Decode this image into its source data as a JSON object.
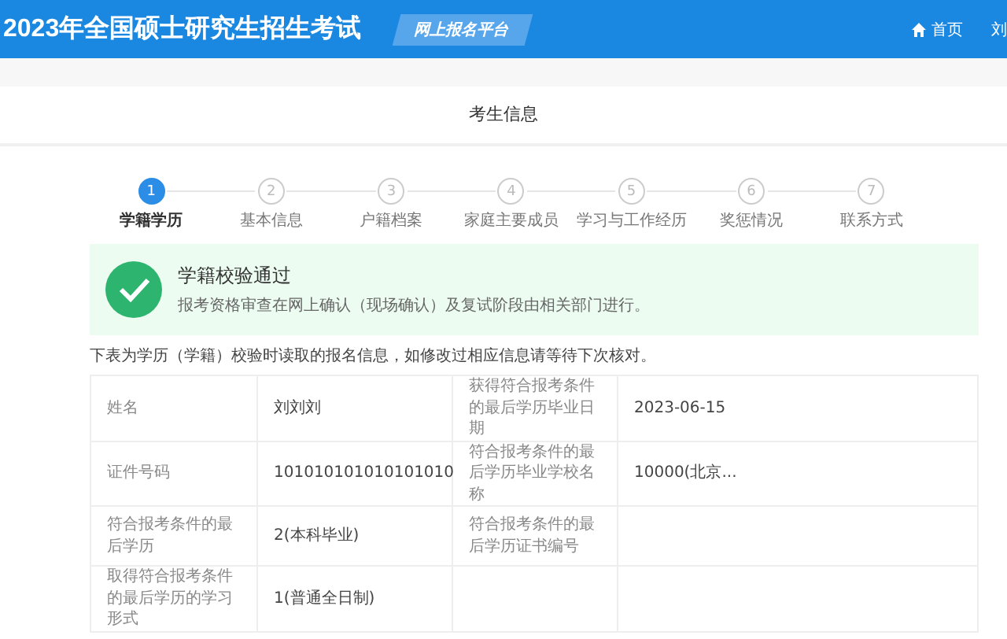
{
  "header": {
    "title": "2023年全国硕士研究生招生考试",
    "platform_badge": "网上报名平台",
    "home_link": "首页",
    "user_name": "刘"
  },
  "page_title": "考生信息",
  "steps": [
    {
      "number": "1",
      "label": "学籍学历",
      "selected": true
    },
    {
      "number": "2",
      "label": "基本信息",
      "selected": false
    },
    {
      "number": "3",
      "label": "户籍档案",
      "selected": false
    },
    {
      "number": "4",
      "label": "家庭主要成员",
      "selected": false
    },
    {
      "number": "5",
      "label": "学习与工作经历",
      "selected": false
    },
    {
      "number": "6",
      "label": "奖惩情况",
      "selected": false
    },
    {
      "number": "7",
      "label": "联系方式",
      "selected": false
    }
  ],
  "success_alert": {
    "title": "学籍校验通过",
    "message": "报考资格审查在网上确认（现场确认）及复试阶段由相关部门进行。"
  },
  "note": "下表为学历（学籍）校验时读取的报名信息，如修改过相应信息请等待下次核对。",
  "table": {
    "rows": [
      {
        "label_1": "姓名",
        "value_1": "刘刘刘",
        "label_2": "获得符合报考条件的最后学历毕业日期",
        "value_2": "2023-06-15"
      },
      {
        "label_1": "证件号码",
        "value_1": "101010101010101010",
        "label_2": "符合报考条件的最后学历毕业学校名称",
        "value_2": "10000(北京..."
      },
      {
        "label_1": "符合报考条件的最后学历",
        "value_1": "2(本科毕业)",
        "label_2": "符合报考条件的最后学历证书编号"
      },
      {
        "label_1": "取得符合报考条件的最后学历的学习形式",
        "value_1": "1(普通全日制)"
      }
    ]
  }
}
